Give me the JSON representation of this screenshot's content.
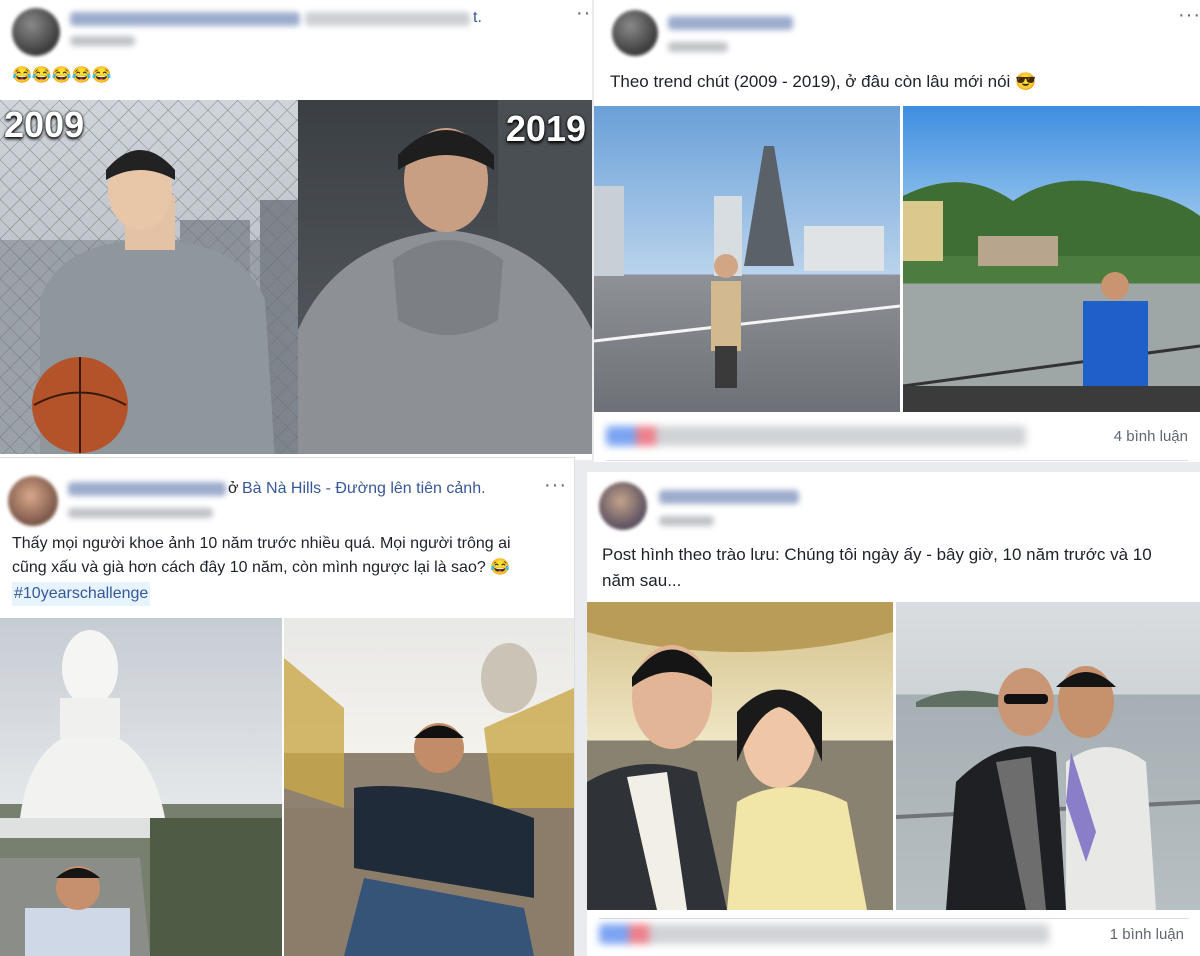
{
  "posts": [
    {
      "id": "post-tl",
      "name_suffix": "t.",
      "text": "😂😂😂😂😂",
      "photos": [
        {
          "year": "2009",
          "subject": "young-man-basketball"
        },
        {
          "year": "2019",
          "subject": "older-man-hoodie"
        }
      ]
    },
    {
      "id": "post-tr",
      "text": "Theo trend chút (2009 - 2019), ở đâu còn lâu mới nói 😎",
      "comments": "4 bình luận",
      "photos": [
        {
          "subject": "man-on-aircraft-carrier"
        },
        {
          "subject": "man-by-lake-castle"
        }
      ]
    },
    {
      "id": "post-bl",
      "location_prefix": "ở",
      "location": "Bà Nà Hills - Đường lên tiên cảnh.",
      "text": "Thấy mọi người khoe ảnh 10 năm trước nhiều quá. Mọi người trông ai cũng xấu và già hơn cách đây 10 năm, còn mình ngược lại là sao? 😂",
      "hashtag": "#10yearschallenge",
      "photos": [
        {
          "subject": "buddha-statue-man"
        },
        {
          "subject": "man-on-golden-bridge"
        }
      ]
    },
    {
      "id": "post-br",
      "text": "Post hình theo trào lưu: Chúng tôi ngày ấy - bây giờ, 10 năm trước và 10 năm sau...",
      "comments": "1 bình luận",
      "photos": [
        {
          "subject": "classic-couple-portrait"
        },
        {
          "subject": "couple-at-sea"
        }
      ]
    }
  ],
  "icons": {
    "more": "more-options-icon"
  },
  "colors": {
    "link": "#365899",
    "hashtag_bg": "#e7f3ff",
    "page_bg": "#e9ebee"
  }
}
